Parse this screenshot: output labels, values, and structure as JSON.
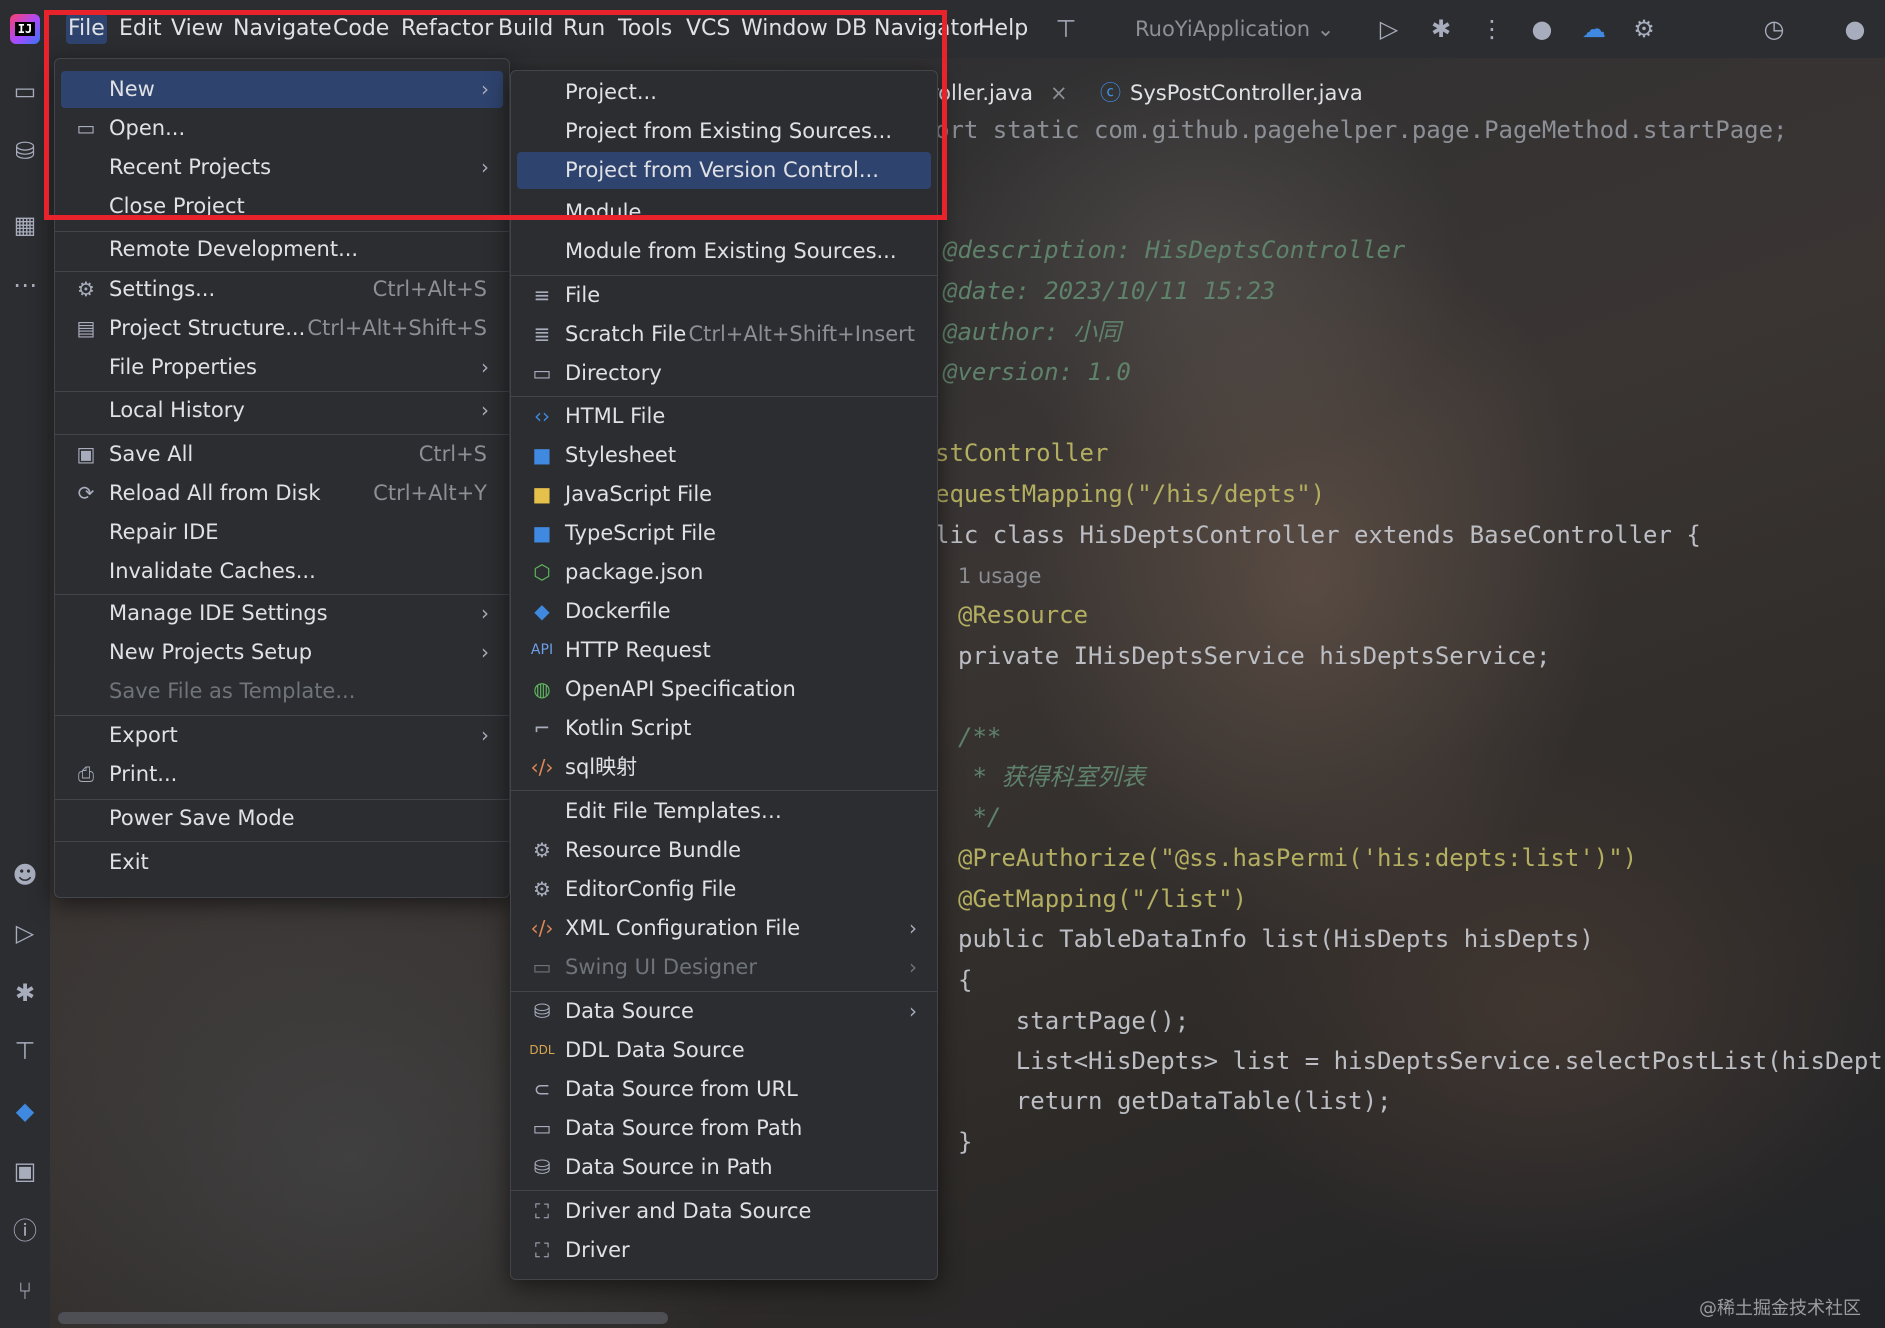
{
  "menubar": {
    "items": [
      "File",
      "Edit",
      "View",
      "Navigate",
      "Code",
      "Refactor",
      "Build",
      "Run",
      "Tools",
      "VCS",
      "Window",
      "DB Navigator",
      "Help"
    ],
    "run_config": "RuoYiApplication ⌄"
  },
  "editor": {
    "tabs": [
      "roller.java",
      "SysPostController.java"
    ],
    "code": [
      "ort static com.github.pagehelper.page.PageMethod.startPage;",
      "@description: HisDeptsController",
      "@date: 2023/10/11 15:23",
      "@author: 小同",
      "@version: 1.0",
      "stController",
      "equestMapping(\"/his/depts\")",
      "lic class HisDeptsController extends BaseController {",
      "1 usage",
      "@Resource",
      "private IHisDeptsService hisDeptsService;",
      "/**",
      " * 获得科室列表",
      " */",
      "@PreAuthorize(\"@ss.hasPermi('his:depts:list')\")",
      "@GetMapping(\"/list\")",
      "public TableDataInfo list(HisDepts hisDepts)",
      "{",
      "    startPage();",
      "    List<HisDepts> list = hisDeptsService.selectPostList(hisDepts)",
      "    return getDataTable(list);",
      "}"
    ]
  },
  "file_menu": {
    "items": [
      {
        "label": "New",
        "shortcut": "",
        "icon": "",
        "submenu": true
      },
      {
        "label": "Open...",
        "shortcut": "",
        "icon": "folder-icon",
        "submenu": false
      },
      {
        "label": "Recent Projects",
        "shortcut": "",
        "icon": "",
        "submenu": true
      },
      {
        "label": "Close Project",
        "shortcut": "",
        "icon": "",
        "submenu": false
      },
      {
        "label": "Remote Development...",
        "shortcut": "",
        "icon": "",
        "submenu": false
      },
      {
        "label": "Settings...",
        "shortcut": "Ctrl+Alt+S",
        "icon": "gear-icon",
        "submenu": false
      },
      {
        "label": "Project Structure...",
        "shortcut": "Ctrl+Alt+Shift+S",
        "icon": "project-structure-icon",
        "submenu": false
      },
      {
        "label": "File Properties",
        "shortcut": "",
        "icon": "",
        "submenu": true
      },
      {
        "label": "Local History",
        "shortcut": "",
        "icon": "",
        "submenu": true
      },
      {
        "label": "Save All",
        "shortcut": "Ctrl+S",
        "icon": "save-icon",
        "submenu": false
      },
      {
        "label": "Reload All from Disk",
        "shortcut": "Ctrl+Alt+Y",
        "icon": "reload-icon",
        "submenu": false
      },
      {
        "label": "Repair IDE",
        "shortcut": "",
        "icon": "",
        "submenu": false
      },
      {
        "label": "Invalidate Caches...",
        "shortcut": "",
        "icon": "",
        "submenu": false
      },
      {
        "label": "Manage IDE Settings",
        "shortcut": "",
        "icon": "",
        "submenu": true
      },
      {
        "label": "New Projects Setup",
        "shortcut": "",
        "icon": "",
        "submenu": true
      },
      {
        "label": "Save File as Template...",
        "shortcut": "",
        "icon": "",
        "submenu": false,
        "disabled": true
      },
      {
        "label": "Export",
        "shortcut": "",
        "icon": "",
        "submenu": true
      },
      {
        "label": "Print...",
        "shortcut": "",
        "icon": "print-icon",
        "submenu": false
      },
      {
        "label": "Power Save Mode",
        "shortcut": "",
        "icon": "",
        "submenu": false
      },
      {
        "label": "Exit",
        "shortcut": "",
        "icon": "",
        "submenu": false
      }
    ]
  },
  "new_submenu": {
    "items": [
      {
        "label": "Project...",
        "shortcut": "",
        "icon": "",
        "submenu": false
      },
      {
        "label": "Project from Existing Sources...",
        "shortcut": "",
        "icon": "",
        "submenu": false
      },
      {
        "label": "Project from Version Control...",
        "shortcut": "",
        "icon": "",
        "submenu": false,
        "highlighted": true
      },
      {
        "label": "Module...",
        "shortcut": "",
        "icon": "",
        "submenu": false
      },
      {
        "label": "Module from Existing Sources...",
        "shortcut": "",
        "icon": "",
        "submenu": false
      },
      {
        "label": "File",
        "shortcut": "",
        "icon": "text-file-icon",
        "submenu": false
      },
      {
        "label": "Scratch File",
        "shortcut": "Ctrl+Alt+Shift+Insert",
        "icon": "scratch-file-icon",
        "submenu": false
      },
      {
        "label": "Directory",
        "shortcut": "",
        "icon": "folder-icon",
        "submenu": false
      },
      {
        "label": "HTML File",
        "shortcut": "",
        "icon": "html-icon",
        "submenu": false
      },
      {
        "label": "Stylesheet",
        "shortcut": "",
        "icon": "css-icon",
        "submenu": false
      },
      {
        "label": "JavaScript File",
        "shortcut": "",
        "icon": "javascript-icon",
        "submenu": false
      },
      {
        "label": "TypeScript File",
        "shortcut": "",
        "icon": "typescript-icon",
        "submenu": false
      },
      {
        "label": "package.json",
        "shortcut": "",
        "icon": "nodejs-icon",
        "submenu": false
      },
      {
        "label": "Dockerfile",
        "shortcut": "",
        "icon": "docker-icon",
        "submenu": false
      },
      {
        "label": "HTTP Request",
        "shortcut": "",
        "icon": "api-icon",
        "submenu": false
      },
      {
        "label": "OpenAPI Specification",
        "shortcut": "",
        "icon": "openapi-icon",
        "submenu": false
      },
      {
        "label": "Kotlin Script",
        "shortcut": "",
        "icon": "kotlin-script-icon",
        "submenu": false
      },
      {
        "label": "sql映射",
        "shortcut": "",
        "icon": "code-tag-icon",
        "submenu": false
      },
      {
        "label": "Edit File Templates…",
        "shortcut": "",
        "icon": "",
        "submenu": false
      },
      {
        "label": "Resource Bundle",
        "shortcut": "",
        "icon": "gear-icon",
        "submenu": false
      },
      {
        "label": "EditorConfig File",
        "shortcut": "",
        "icon": "gear-icon",
        "submenu": false
      },
      {
        "label": "XML Configuration File",
        "shortcut": "",
        "icon": "xml-icon",
        "submenu": true
      },
      {
        "label": "Swing UI Designer",
        "shortcut": "",
        "icon": "form-icon",
        "submenu": true,
        "disabled": true
      },
      {
        "label": "Data Source",
        "shortcut": "",
        "icon": "database-icon",
        "submenu": true
      },
      {
        "label": "DDL Data Source",
        "shortcut": "",
        "icon": "ddl-icon",
        "submenu": false
      },
      {
        "label": "Data Source from URL",
        "shortcut": "",
        "icon": "plug-icon",
        "submenu": false
      },
      {
        "label": "Data Source from Path",
        "shortcut": "",
        "icon": "folder-icon",
        "submenu": false
      },
      {
        "label": "Data Source in Path",
        "shortcut": "",
        "icon": "database-icon",
        "submenu": false
      },
      {
        "label": "Driver and Data Source",
        "shortcut": "",
        "icon": "driver-icon",
        "submenu": false
      },
      {
        "label": "Driver",
        "shortcut": "",
        "icon": "driver-icon",
        "submenu": false
      }
    ]
  },
  "watermark": "@稀土掘金技术社区",
  "colors": {
    "highlight": "#2e436e",
    "annotation_box": "#e8232b",
    "menu_bg": "#2b2d30"
  }
}
